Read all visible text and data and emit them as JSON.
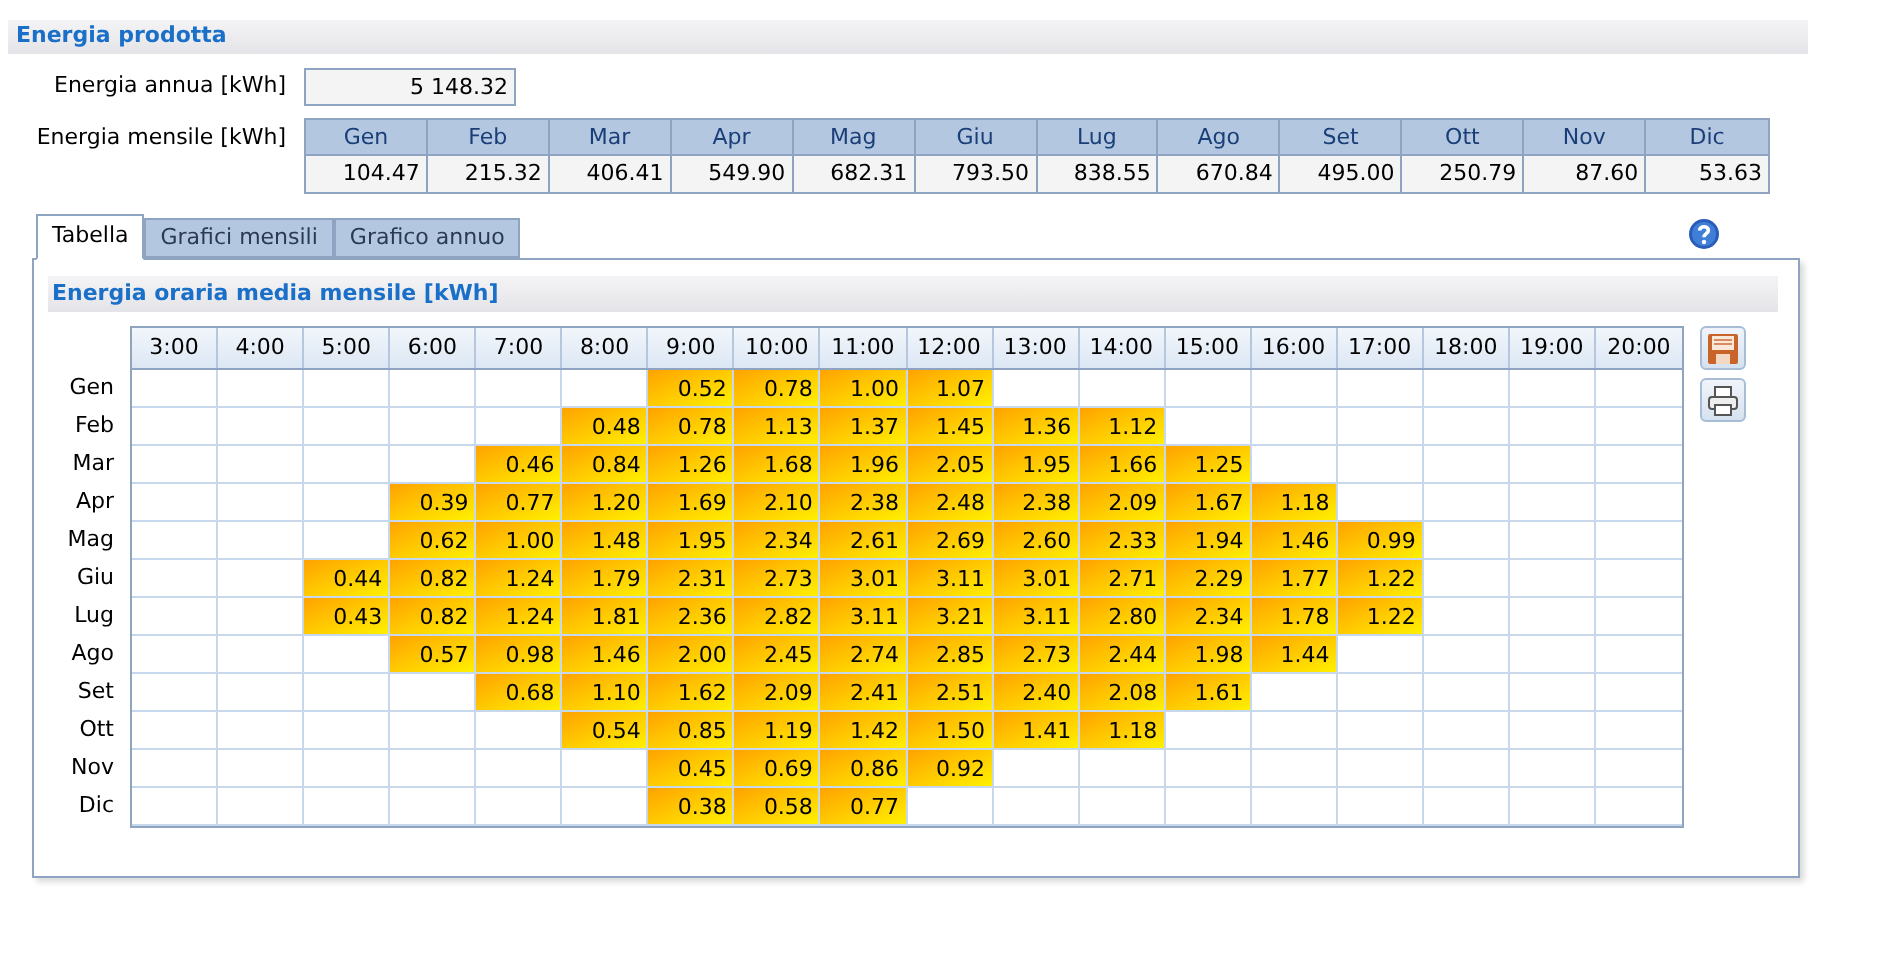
{
  "section_title": "Energia prodotta",
  "annual": {
    "label": "Energia annua [kWh]",
    "value": "5 148.32"
  },
  "monthly": {
    "label": "Energia mensile [kWh]",
    "months": [
      "Gen",
      "Feb",
      "Mar",
      "Apr",
      "Mag",
      "Giu",
      "Lug",
      "Ago",
      "Set",
      "Ott",
      "Nov",
      "Dic"
    ],
    "values": [
      "104.47",
      "215.32",
      "406.41",
      "549.90",
      "682.31",
      "793.50",
      "838.55",
      "670.84",
      "495.00",
      "250.79",
      "87.60",
      "53.63"
    ]
  },
  "tabs": [
    {
      "label": "Tabella",
      "selected": true
    },
    {
      "label": "Grafici mensili",
      "selected": false
    },
    {
      "label": "Grafico annuo",
      "selected": false
    }
  ],
  "panel_title": "Energia oraria media mensile [kWh]",
  "table": {
    "columns": [
      "3:00",
      "4:00",
      "5:00",
      "6:00",
      "7:00",
      "8:00",
      "9:00",
      "10:00",
      "11:00",
      "12:00",
      "13:00",
      "14:00",
      "15:00",
      "16:00",
      "17:00",
      "18:00",
      "19:00",
      "20:00"
    ],
    "rows": [
      {
        "label": "Gen",
        "cells": [
          null,
          null,
          null,
          null,
          null,
          null,
          "0.52",
          "0.78",
          "1.00",
          "1.07",
          null,
          null,
          null,
          null,
          null,
          null,
          null,
          null
        ]
      },
      {
        "label": "Feb",
        "cells": [
          null,
          null,
          null,
          null,
          null,
          "0.48",
          "0.78",
          "1.13",
          "1.37",
          "1.45",
          "1.36",
          "1.12",
          null,
          null,
          null,
          null,
          null,
          null
        ]
      },
      {
        "label": "Mar",
        "cells": [
          null,
          null,
          null,
          null,
          "0.46",
          "0.84",
          "1.26",
          "1.68",
          "1.96",
          "2.05",
          "1.95",
          "1.66",
          "1.25",
          null,
          null,
          null,
          null,
          null
        ]
      },
      {
        "label": "Apr",
        "cells": [
          null,
          null,
          null,
          "0.39",
          "0.77",
          "1.20",
          "1.69",
          "2.10",
          "2.38",
          "2.48",
          "2.38",
          "2.09",
          "1.67",
          "1.18",
          null,
          null,
          null,
          null
        ]
      },
      {
        "label": "Mag",
        "cells": [
          null,
          null,
          null,
          "0.62",
          "1.00",
          "1.48",
          "1.95",
          "2.34",
          "2.61",
          "2.69",
          "2.60",
          "2.33",
          "1.94",
          "1.46",
          "0.99",
          null,
          null,
          null
        ]
      },
      {
        "label": "Giu",
        "cells": [
          null,
          null,
          "0.44",
          "0.82",
          "1.24",
          "1.79",
          "2.31",
          "2.73",
          "3.01",
          "3.11",
          "3.01",
          "2.71",
          "2.29",
          "1.77",
          "1.22",
          null,
          null,
          null
        ]
      },
      {
        "label": "Lug",
        "cells": [
          null,
          null,
          "0.43",
          "0.82",
          "1.24",
          "1.81",
          "2.36",
          "2.82",
          "3.11",
          "3.21",
          "3.11",
          "2.80",
          "2.34",
          "1.78",
          "1.22",
          null,
          null,
          null
        ]
      },
      {
        "label": "Ago",
        "cells": [
          null,
          null,
          null,
          "0.57",
          "0.98",
          "1.46",
          "2.00",
          "2.45",
          "2.74",
          "2.85",
          "2.73",
          "2.44",
          "1.98",
          "1.44",
          null,
          null,
          null,
          null
        ]
      },
      {
        "label": "Set",
        "cells": [
          null,
          null,
          null,
          null,
          "0.68",
          "1.10",
          "1.62",
          "2.09",
          "2.41",
          "2.51",
          "2.40",
          "2.08",
          "1.61",
          null,
          null,
          null,
          null,
          null
        ]
      },
      {
        "label": "Ott",
        "cells": [
          null,
          null,
          null,
          null,
          null,
          "0.54",
          "0.85",
          "1.19",
          "1.42",
          "1.50",
          "1.41",
          "1.18",
          null,
          null,
          null,
          null,
          null,
          null
        ]
      },
      {
        "label": "Nov",
        "cells": [
          null,
          null,
          null,
          null,
          null,
          null,
          "0.45",
          "0.69",
          "0.86",
          "0.92",
          null,
          null,
          null,
          null,
          null,
          null,
          null,
          null
        ]
      },
      {
        "label": "Dic",
        "cells": [
          null,
          null,
          null,
          null,
          null,
          null,
          "0.38",
          "0.58",
          "0.77",
          null,
          null,
          null,
          null,
          null,
          null,
          null,
          null,
          null
        ]
      }
    ]
  }
}
